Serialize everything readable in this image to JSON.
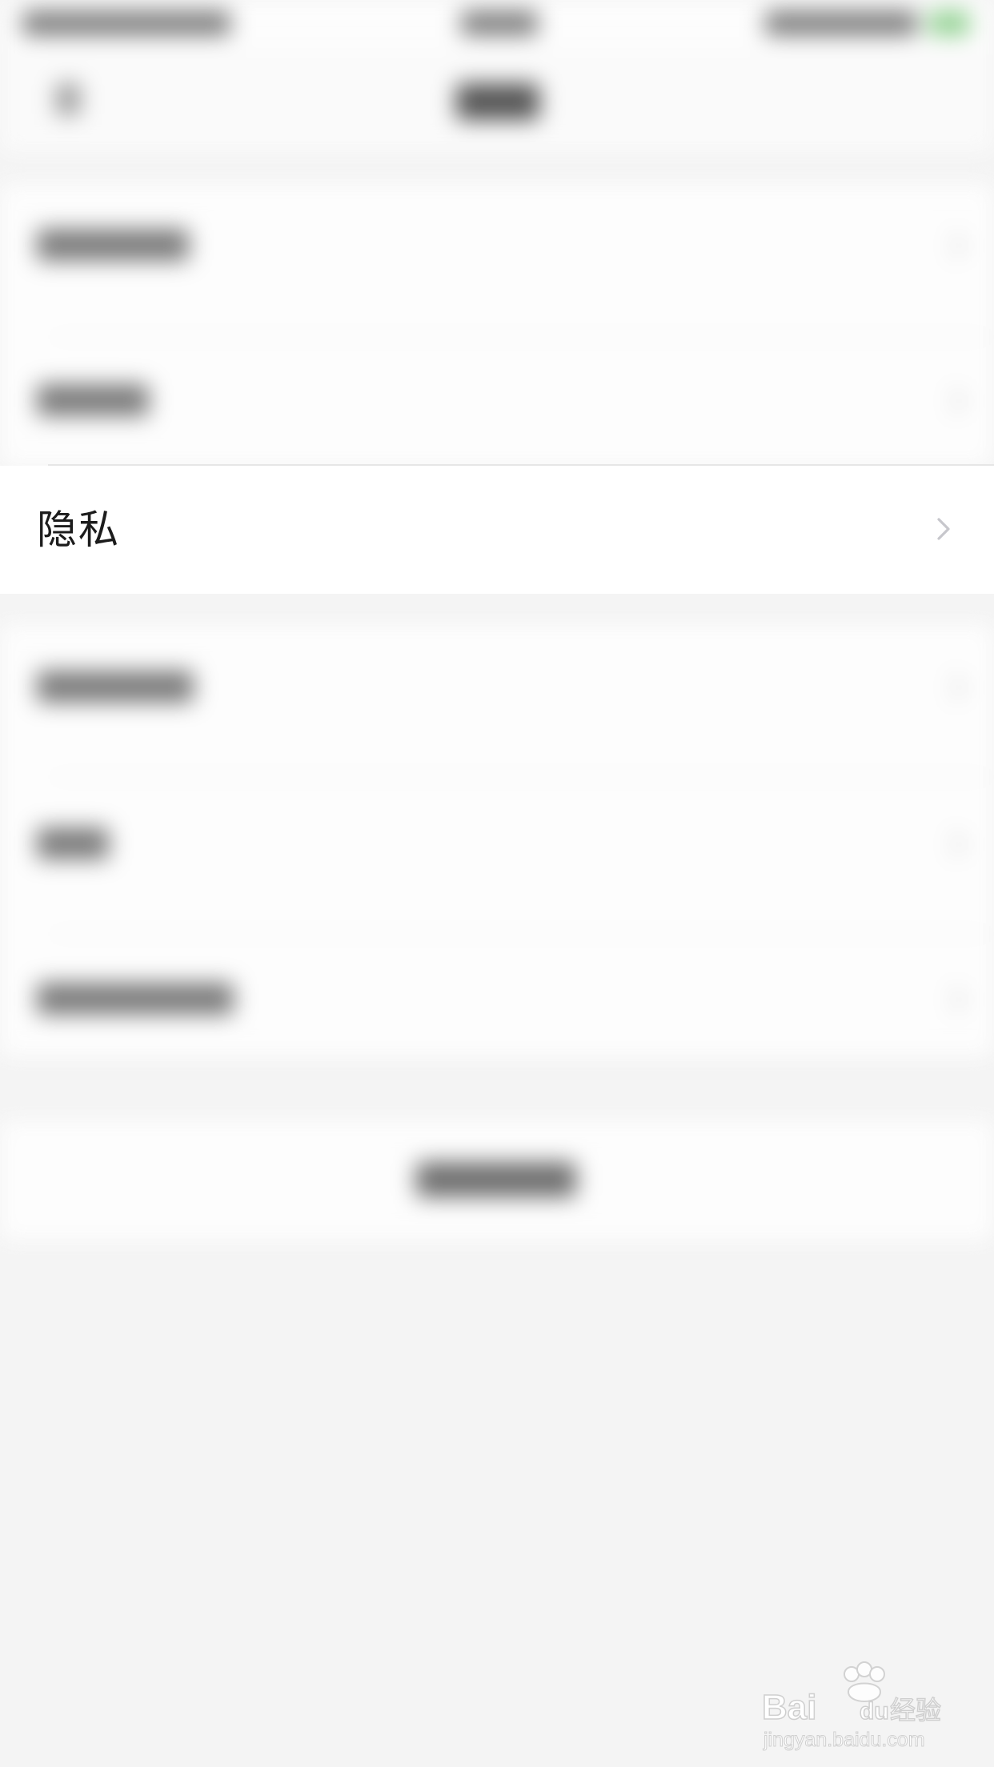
{
  "settings": {
    "privacy_label": "隐私"
  },
  "icons": {
    "privacy_chevron": "chevron-right-icon"
  },
  "watermark": {
    "brand": "Bai du 经验",
    "url": "jingyan.baidu.com"
  },
  "colors": {
    "row_background": "#ffffff",
    "page_background": "#f4f4f4",
    "label_text": "#1c1c1c",
    "chevron": "#c7c7cc"
  }
}
